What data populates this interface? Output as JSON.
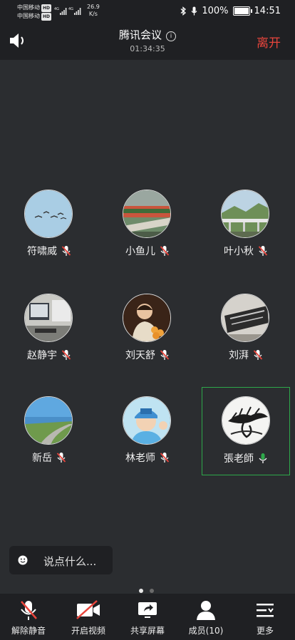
{
  "status_bar": {
    "carrier_1": "中国移动",
    "carrier_2": "中国移动",
    "hd_badge": "HD",
    "net_1": "4G",
    "net_2": "4G",
    "speed_value": "26.9",
    "speed_unit": "K/s",
    "battery": "100%",
    "battery_level": 1.0,
    "time": "14:51"
  },
  "header": {
    "title": "腾讯会议",
    "duration": "01:34:35",
    "leave_label": "离开",
    "leave_color": "#e8453c"
  },
  "participants": [
    {
      "name": "符啸威",
      "muted": true,
      "active": false,
      "avatar_icon": "birds-sky-photo"
    },
    {
      "name": "小鱼儿",
      "muted": true,
      "active": false,
      "avatar_icon": "flowers-bench-photo"
    },
    {
      "name": "叶小秋",
      "muted": true,
      "active": false,
      "avatar_icon": "bridge-mountain-photo"
    },
    {
      "name": "赵静宇",
      "muted": true,
      "active": false,
      "avatar_icon": "desk-monitor-photo"
    },
    {
      "name": "刘天舒",
      "muted": true,
      "active": false,
      "avatar_icon": "child-portrait-photo"
    },
    {
      "name": "刘湃",
      "muted": true,
      "active": false,
      "avatar_icon": "engraved-sign-photo"
    },
    {
      "name": "新岳",
      "muted": true,
      "active": false,
      "avatar_icon": "coastal-road-photo"
    },
    {
      "name": "林老师",
      "muted": true,
      "active": false,
      "avatar_icon": "boy-cap-photo"
    },
    {
      "name": "張老師",
      "muted": false,
      "active": true,
      "avatar_icon": "ink-pine-painting"
    }
  ],
  "chat": {
    "placeholder": "说点什么..."
  },
  "pager": {
    "pages": 2,
    "current": 1
  },
  "toolbar": {
    "unmute": "解除静音",
    "video": "开启视频",
    "share": "共享屏幕",
    "members": "成员(10)",
    "more": "更多"
  },
  "colors": {
    "muted_mic": "#e8453c",
    "active_mic": "#2ea84a",
    "active_border": "#2ea84a",
    "background": "#2b2d30",
    "bar": "#1f2023"
  }
}
